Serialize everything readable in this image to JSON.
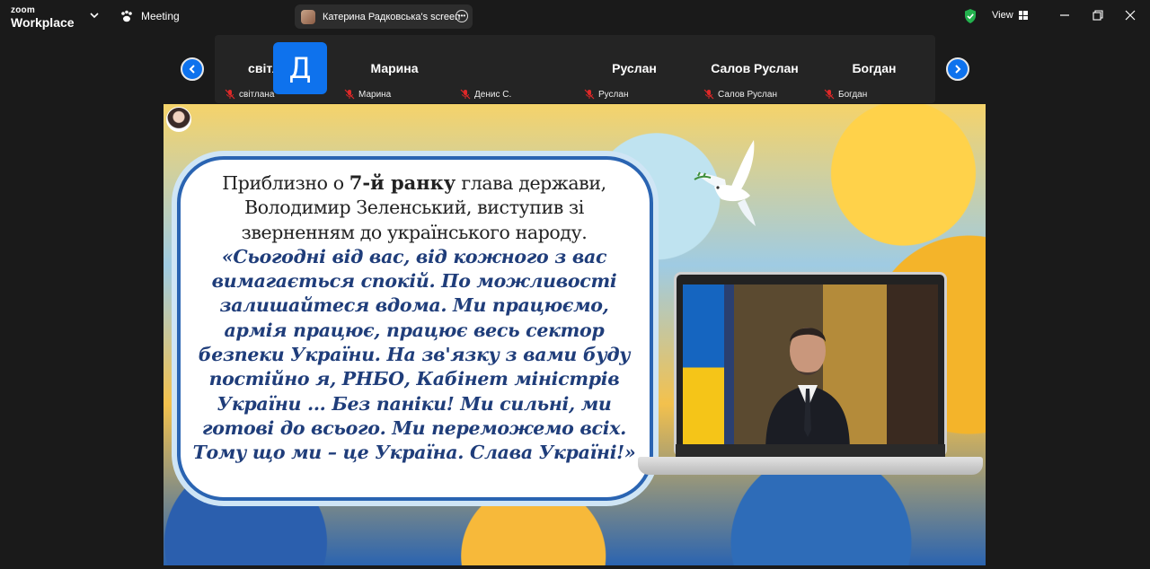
{
  "app": {
    "logo_top": "zoom",
    "logo_bottom": "Workplace",
    "meeting_label": "Meeting",
    "share_label": "Катерина Радковська's screen",
    "view_label": "View"
  },
  "participants": {
    "prev_button": "‹",
    "next_button": "›",
    "tiles": [
      {
        "display": "світлана",
        "label": "світлана",
        "muted": true
      },
      {
        "display": "Марина",
        "label": "Марина",
        "muted": true
      },
      {
        "display": "Д",
        "label": "Денис С.",
        "muted": true,
        "avatar": true
      },
      {
        "display": "Руслан",
        "label": "Руслан",
        "muted": true
      },
      {
        "display": "Салов Руслан",
        "label": "Салов Руслан",
        "muted": true
      },
      {
        "display": "Богдан",
        "label": "Богдан",
        "muted": true
      }
    ]
  },
  "slide": {
    "intro_a": "Приблизно о ",
    "intro_bold": "7-й ранку",
    "intro_b": " глава держави, Володимир Зеленський, виступив зі зверненням до українського народу.",
    "quote": "«Сьогодні від вас, від кожного з вас вимагається спокій. По можливості залишайтеся вдома. Ми працюємо, армія працює, працює весь сектор безпеки України. На зв'язку з вами буду постійно я, РНБО, Кабінет міністрів України ... Без паніки! Ми сильні, ми готові до всього. Ми переможемо всіх. Тому що ми – це Україна. Слава Україні!»"
  },
  "colors": {
    "zoom_blue": "#0e72ed",
    "quote_blue": "#1f3d7a",
    "security_green": "#23b14d"
  }
}
